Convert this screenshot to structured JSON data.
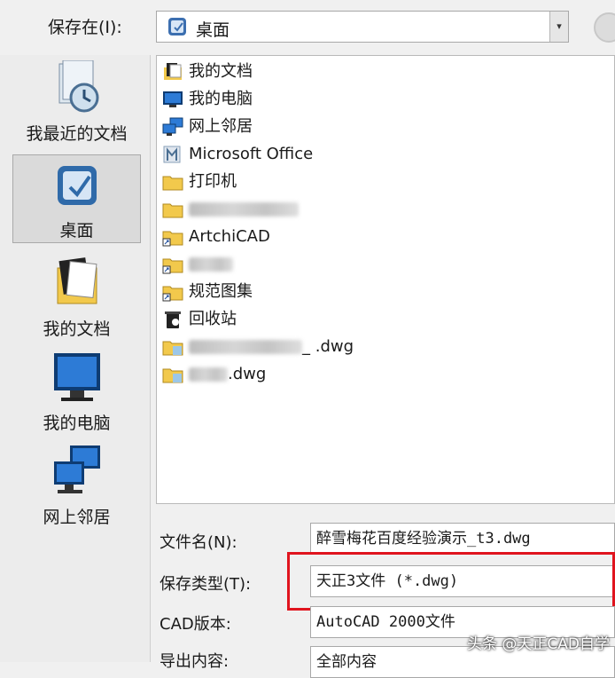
{
  "save_in": {
    "label": "保存在(I):",
    "location": "桌面",
    "dropdown_icon": "chevron-down-icon",
    "up_button_icon": "up-folder-icon"
  },
  "places": [
    {
      "label": "我最近的文档",
      "icon": "recent-documents-icon",
      "selected": false
    },
    {
      "label": "桌面",
      "icon": "desktop-icon",
      "selected": true
    },
    {
      "label": "我的文档",
      "icon": "my-documents-icon",
      "selected": false
    },
    {
      "label": "我的电脑",
      "icon": "my-computer-icon",
      "selected": false
    },
    {
      "label": "网上邻居",
      "icon": "network-places-icon",
      "selected": false
    }
  ],
  "files": [
    {
      "name": "我的文档",
      "icon": "my-documents-icon"
    },
    {
      "name": "我的电脑",
      "icon": "my-computer-icon"
    },
    {
      "name": "网上邻居",
      "icon": "network-places-icon"
    },
    {
      "name": "Microsoft Office",
      "icon": "office-icon"
    },
    {
      "name": "打印机",
      "icon": "folder-icon"
    },
    {
      "name": "",
      "icon": "folder-icon",
      "obscured": true
    },
    {
      "name": "ArtchiCAD",
      "icon": "shortcut-folder-icon"
    },
    {
      "name": "",
      "icon": "shortcut-folder-icon",
      "obscured": true
    },
    {
      "name": "规范图集",
      "icon": "shortcut-folder-icon"
    },
    {
      "name": "回收站",
      "icon": "recycle-bin-icon"
    },
    {
      "name": "_ .dwg",
      "icon": "dwg-file-icon",
      "obscured": true
    },
    {
      "name": ".dwg",
      "icon": "dwg-file-icon",
      "obscured": true
    }
  ],
  "fields": {
    "filename_label": "文件名(N):",
    "filename_value": "醉雪梅花百度经验演示_t3.dwg",
    "filetype_label": "保存类型(T):",
    "filetype_value": "天正3文件 (*.dwg)",
    "cad_version_label": "CAD版本:",
    "cad_version_value": "AutoCAD 2000文件",
    "export_label": "导出内容:",
    "export_value": "全部内容"
  },
  "watermark": "头条 @天正CAD自学",
  "colors": {
    "highlight": "#e0141e",
    "folder": "#f2c94c"
  }
}
